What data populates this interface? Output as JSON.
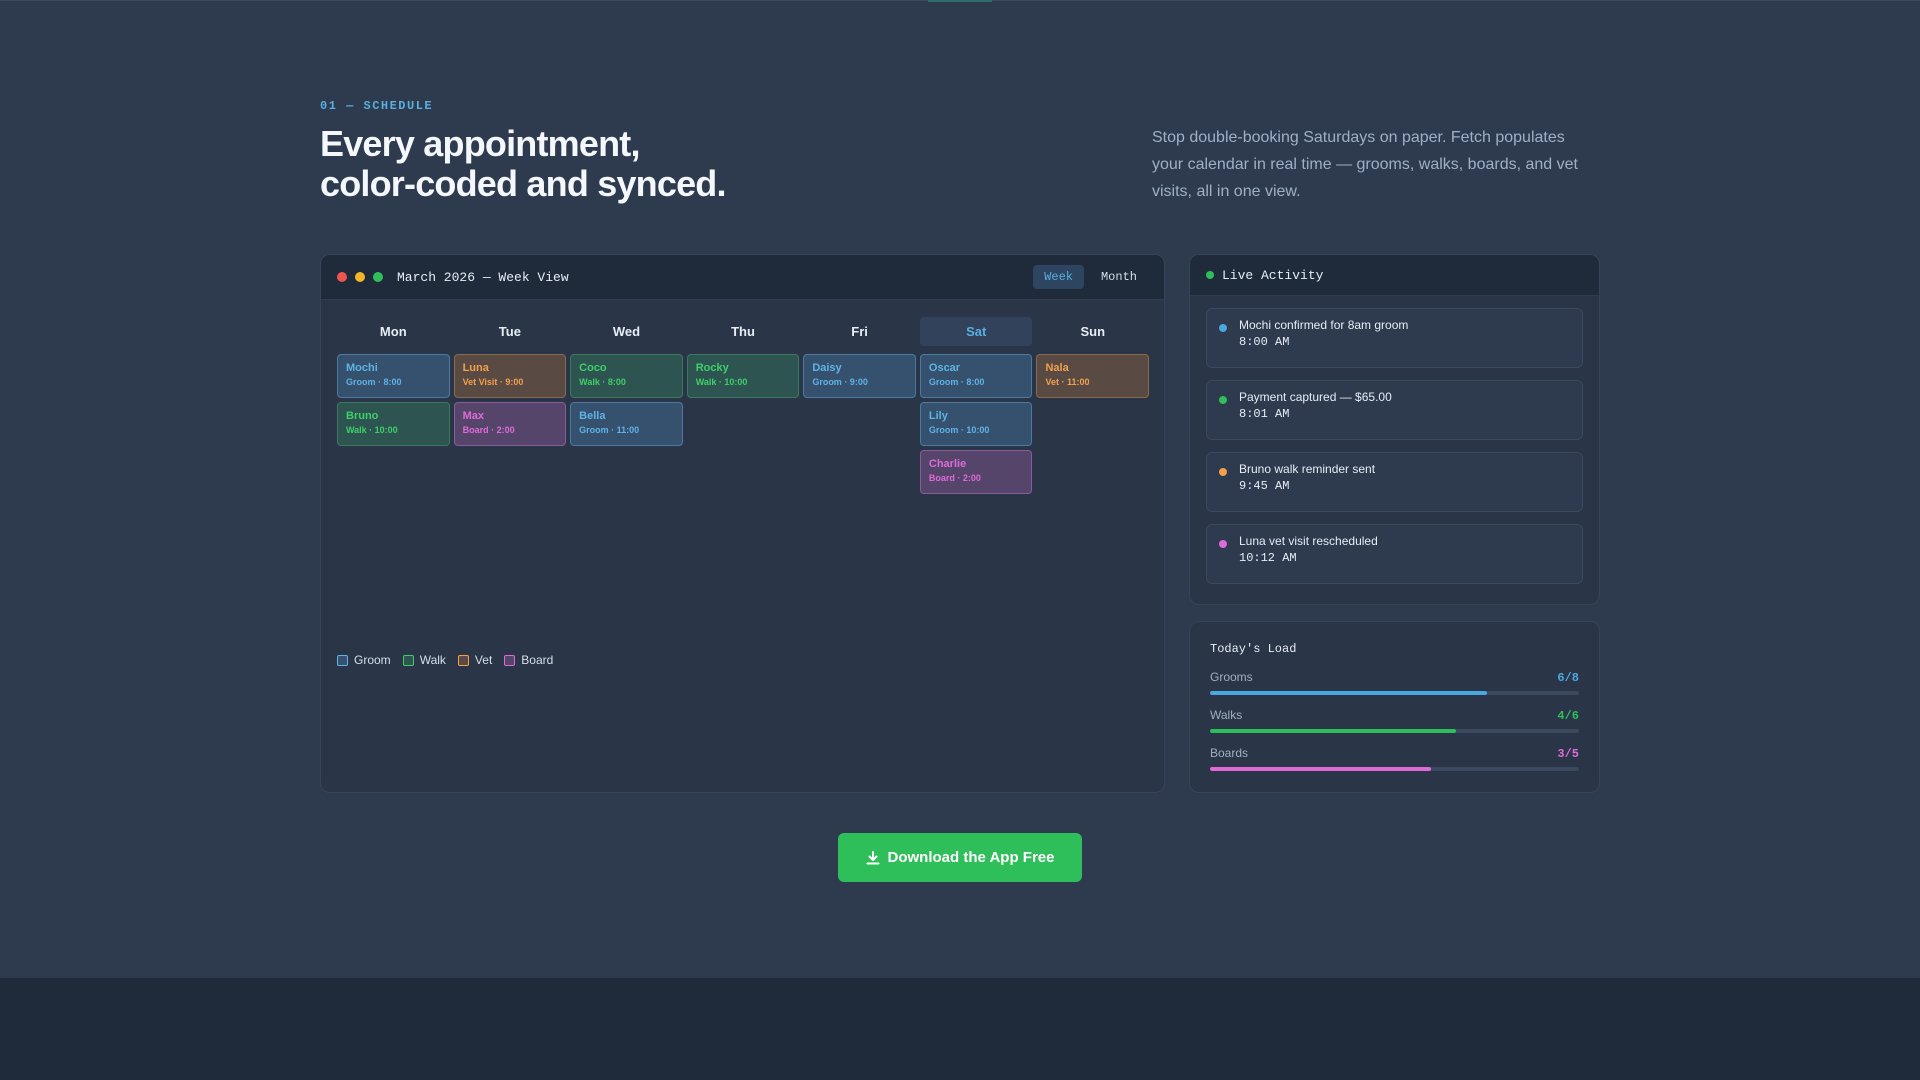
{
  "section": {
    "label": "01 — SCHEDULE",
    "headline_line1": "Every appointment,",
    "headline_line2": "color-coded and synced.",
    "intro": "Stop double-booking Saturdays on paper. Fetch populates your calendar in real time — grooms, walks, boards, and vet visits, all in one view."
  },
  "calendar": {
    "title": "March 2026 — Week View",
    "views": [
      "Week",
      "Month"
    ],
    "active_view": "Week",
    "days": [
      {
        "label": "Mon",
        "today": false,
        "appts": [
          {
            "name": "Mochi",
            "meta": "Groom · 8:00",
            "type": "groom"
          },
          {
            "name": "Bruno",
            "meta": "Walk · 10:00",
            "type": "walk"
          }
        ]
      },
      {
        "label": "Tue",
        "today": false,
        "appts": [
          {
            "name": "Luna",
            "meta": "Vet Visit · 9:00",
            "type": "vet"
          },
          {
            "name": "Max",
            "meta": "Board · 2:00",
            "type": "board"
          }
        ]
      },
      {
        "label": "Wed",
        "today": false,
        "appts": [
          {
            "name": "Coco",
            "meta": "Walk · 8:00",
            "type": "walk"
          },
          {
            "name": "Bella",
            "meta": "Groom · 11:00",
            "type": "groom"
          }
        ]
      },
      {
        "label": "Thu",
        "today": false,
        "appts": [
          {
            "name": "Rocky",
            "meta": "Walk · 10:00",
            "type": "walk"
          }
        ]
      },
      {
        "label": "Fri",
        "today": false,
        "appts": [
          {
            "name": "Daisy",
            "meta": "Groom · 9:00",
            "type": "groom"
          }
        ]
      },
      {
        "label": "Sat",
        "today": true,
        "appts": [
          {
            "name": "Oscar",
            "meta": "Groom · 8:00",
            "type": "groom"
          },
          {
            "name": "Lily",
            "meta": "Groom · 10:00",
            "type": "groom"
          },
          {
            "name": "Charlie",
            "meta": "Board · 2:00",
            "type": "board"
          }
        ]
      },
      {
        "label": "Sun",
        "today": false,
        "appts": [
          {
            "name": "Nala",
            "meta": "Vet · 11:00",
            "type": "vet"
          }
        ]
      }
    ],
    "legend": [
      {
        "label": "Groom",
        "type": "groom"
      },
      {
        "label": "Walk",
        "type": "walk"
      },
      {
        "label": "Vet",
        "type": "vet"
      },
      {
        "label": "Board",
        "type": "board"
      }
    ]
  },
  "activity": {
    "title": "Live Activity",
    "items": [
      {
        "text": "Mochi confirmed for 8am groom",
        "time": "8:00 AM",
        "color": "#4aa8e0"
      },
      {
        "text": "Payment captured — $65.00",
        "time": "8:01 AM",
        "color": "#2fbf5a"
      },
      {
        "text": "Bruno walk reminder sent",
        "time": "9:45 AM",
        "color": "#f3a04b"
      },
      {
        "text": "Luna vet visit rescheduled",
        "time": "10:12 AM",
        "color": "#e06ad8"
      }
    ]
  },
  "load": {
    "title": "Today's Load",
    "rows": [
      {
        "label": "Grooms",
        "value": "6/8",
        "fraction": 0.75,
        "color": "#4aa8e0"
      },
      {
        "label": "Walks",
        "value": "4/6",
        "fraction": 0.667,
        "color": "#2fbf5a"
      },
      {
        "label": "Boards",
        "value": "3/5",
        "fraction": 0.6,
        "color": "#e06ad8"
      }
    ]
  },
  "cta": {
    "label": "Download the App Free",
    "icon": "download-icon"
  },
  "colors": {
    "accent_blue": "#5aaee0",
    "accent_green": "#2fbf5a",
    "window_red": "#f0544f",
    "window_yellow": "#f3b62b",
    "window_green": "#2fbf5a"
  }
}
